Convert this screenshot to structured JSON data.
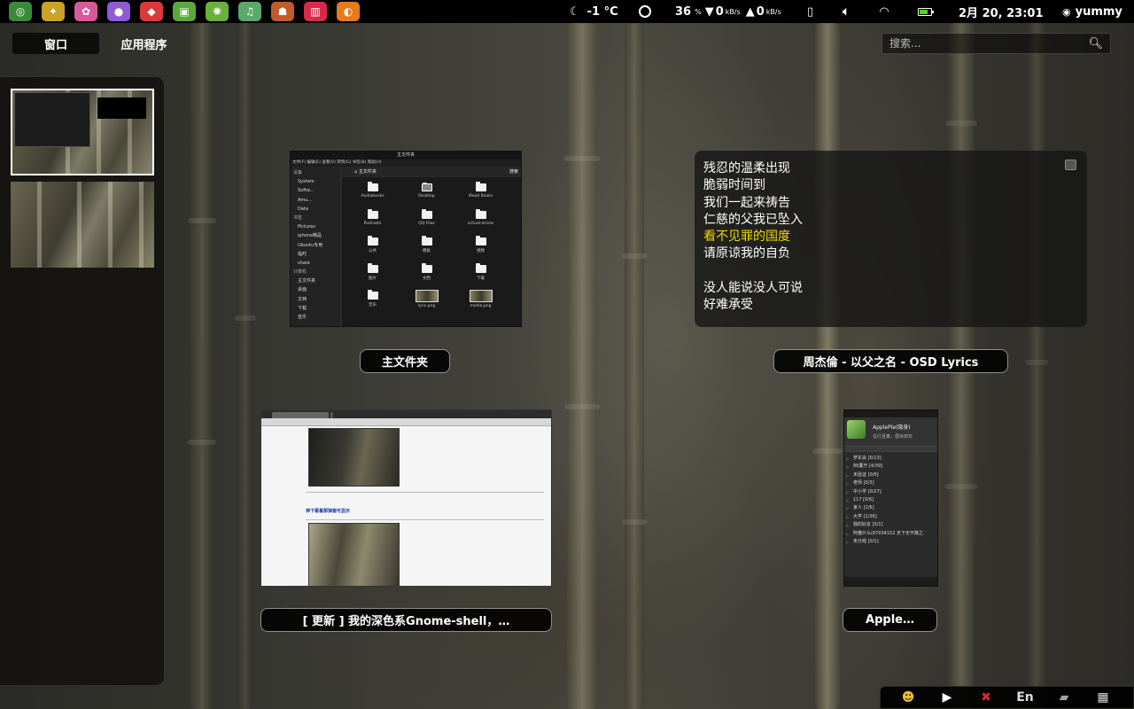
{
  "topbar": {
    "launchers": [
      {
        "name": "launcher-app-green-swirl-icon",
        "glyph": "◎",
        "color": "#3a8a3a"
      },
      {
        "name": "launcher-app-yellow-bird-icon",
        "glyph": "✦",
        "color": "#c9a227"
      },
      {
        "name": "launcher-app-colorful-icon",
        "glyph": "✿",
        "color": "#d65a9a"
      },
      {
        "name": "launcher-app-chat-bubble-icon",
        "glyph": "●",
        "color": "#8e5ad6"
      },
      {
        "name": "launcher-app-red-icon",
        "glyph": "◆",
        "color": "#d63a3a"
      },
      {
        "name": "launcher-app-green-box-icon",
        "glyph": "▣",
        "color": "#5aa83a"
      },
      {
        "name": "launcher-app-palette-icon",
        "glyph": "✺",
        "color": "#6ab03a"
      },
      {
        "name": "launcher-app-music-icon",
        "glyph": "♫",
        "color": "#5aa86a"
      },
      {
        "name": "launcher-app-drum-icon",
        "glyph": "☗",
        "color": "#c45a2a"
      },
      {
        "name": "launcher-app-piano-icon",
        "glyph": "▥",
        "color": "#d62a4a"
      },
      {
        "name": "launcher-app-shield-icon",
        "glyph": "◐",
        "color": "#e87a1a"
      }
    ],
    "weather": "-1 °C",
    "cpu": "36",
    "cpu_unit": "%",
    "net_down": "0",
    "net_up": "0",
    "net_unit": "kB/s",
    "datetime": "2月 20, 23:01",
    "user": "yummy"
  },
  "overview": {
    "tab_windows": "窗口",
    "tab_apps": "应用程序",
    "search_placeholder": "搜索..."
  },
  "windows": {
    "file_manager": {
      "caption": "主文件夹",
      "title": "主文件夹",
      "menu": "文件(F) 编辑(E) 查看(V) 转到(G) 书签(B) 帮助(H)",
      "path": "主文件夹",
      "search_label": "搜索",
      "sidebar": [
        {
          "label": "设备",
          "hdr": true
        },
        {
          "label": "System"
        },
        {
          "label": "Softw..."
        },
        {
          "label": "Amu..."
        },
        {
          "label": "Data"
        },
        {
          "label": "书签",
          "hdr": true
        },
        {
          "label": "Pictures"
        },
        {
          "label": "iphone精品"
        },
        {
          "label": "Ubuntu专用"
        },
        {
          "label": "临时"
        },
        {
          "label": "share"
        },
        {
          "label": "计算机",
          "hdr": true
        },
        {
          "label": "主文件夹"
        },
        {
          "label": "桌面"
        },
        {
          "label": "文档"
        },
        {
          "label": "下载"
        },
        {
          "label": "音乐"
        }
      ],
      "items": [
        {
          "label": "Audiobooks",
          "kind": "folder"
        },
        {
          "label": "Desktop",
          "kind": "desktop"
        },
        {
          "label": "iRead Books",
          "kind": "folder"
        },
        {
          "label": "Podcasts",
          "kind": "folder"
        },
        {
          "label": "QQ Files",
          "kind": "folder"
        },
        {
          "label": "virtual-drives",
          "kind": "folder"
        },
        {
          "label": "公共",
          "kind": "folder"
        },
        {
          "label": "模板",
          "kind": "folder"
        },
        {
          "label": "视频",
          "kind": "folder"
        },
        {
          "label": "图片",
          "kind": "folder"
        },
        {
          "label": "文档",
          "kind": "folder"
        },
        {
          "label": "下载",
          "kind": "folder"
        },
        {
          "label": "音乐",
          "kind": "folder"
        },
        {
          "label": "lyric.png",
          "kind": "image"
        },
        {
          "label": "media.png",
          "kind": "image"
        }
      ]
    },
    "osd": {
      "caption": "周杰倫 - 以父之名 - OSD Lyrics",
      "lines": [
        {
          "text": "残忍的温柔出现"
        },
        {
          "text": "脆弱时间到"
        },
        {
          "text": "我们一起来祷告"
        },
        {
          "text": "仁慈的父我已坠入"
        },
        {
          "text": "看不见罪的国度",
          "active": true
        },
        {
          "text": "请原谅我的自负"
        },
        {
          "text": "",
          "gap": true
        },
        {
          "text": "没人能说没人可说"
        },
        {
          "text": "好难承受"
        }
      ]
    },
    "browser": {
      "caption": "[ 更新 ] 我的深色系Gnome-shell，…",
      "heading": "神下看着那弹窗可显示"
    },
    "qq": {
      "caption": "Apple…",
      "profile_name": "ApplePie(隐身)",
      "signature": "在行且奏，昼尚却日",
      "groups": [
        "罗车会 [0/13]",
        "88厦厅 [4/39]",
        "未验证 [0/0]",
        "老师 [0/3]",
        "中小学 [0/27]",
        "117 [0/6]",
        "家人 [1/6]",
        "大学 [1/36]",
        "我的好友 [0/1]",
        "阿猫什么(67034152 天下无不散之",
        "未分组 [0/1]"
      ]
    }
  },
  "tray": {
    "items": [
      {
        "name": "qq-penguin-icon",
        "glyph": "☻",
        "color": "#e8c030"
      },
      {
        "name": "play-arrow-icon",
        "glyph": "▶",
        "color": "#ffffff"
      },
      {
        "name": "close-red-icon",
        "glyph": "✖",
        "color": "#d62a2a"
      },
      {
        "name": "input-method-label",
        "glyph": "En",
        "color": "#dddddd"
      },
      {
        "name": "drive-icon",
        "glyph": "▰",
        "color": "#9aa0a8"
      },
      {
        "name": "chip-icon",
        "glyph": "▦",
        "color": "#dddddd"
      }
    ]
  }
}
